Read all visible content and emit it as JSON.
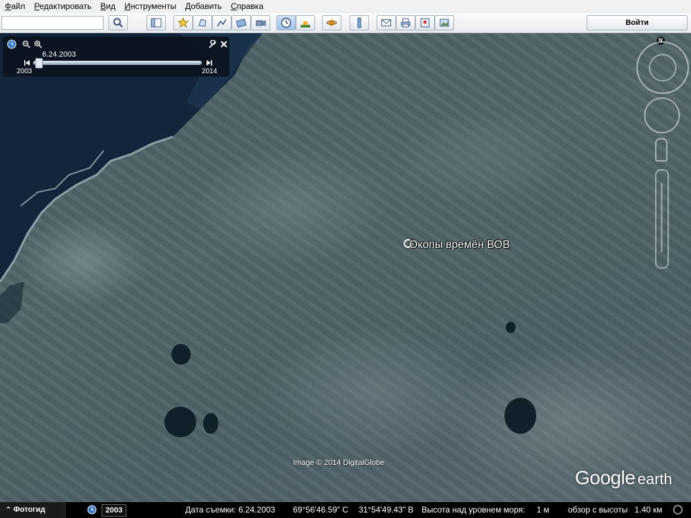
{
  "menu": {
    "items": [
      {
        "label": "Файл",
        "mnemonic": "Ф",
        "rest": "айл"
      },
      {
        "label": "Редактировать",
        "mnemonic": "Р",
        "rest": "едактировать"
      },
      {
        "label": "Вид",
        "mnemonic": "В",
        "rest": "ид"
      },
      {
        "label": "Инструменты",
        "mnemonic": "И",
        "rest": "нструменты"
      },
      {
        "label": "Добавить",
        "mnemonic": "Д",
        "rest": "обавить"
      },
      {
        "label": "Справка",
        "mnemonic": "С",
        "rest": "правка"
      }
    ]
  },
  "toolbar": {
    "search_value": "",
    "signin_label": "Войти",
    "buttons": [
      {
        "name": "search-icon"
      },
      {
        "name": "sidebar-toggle-icon"
      },
      {
        "name": "add-placemark-icon"
      },
      {
        "name": "add-polygon-icon"
      },
      {
        "name": "add-path-icon"
      },
      {
        "name": "image-overlay-icon"
      },
      {
        "name": "record-tour-icon"
      },
      {
        "name": "historical-imagery-icon"
      },
      {
        "name": "sunlight-icon"
      },
      {
        "name": "switch-to-sky-icon"
      },
      {
        "name": "ruler-icon"
      },
      {
        "name": "email-icon"
      },
      {
        "name": "print-icon"
      },
      {
        "name": "view-in-maps-icon"
      },
      {
        "name": "save-image-icon"
      }
    ]
  },
  "time_slider": {
    "current_date": "6.24.2003",
    "start_year": "2003",
    "end_year": "2014",
    "position_fraction": 0.0
  },
  "map": {
    "placemark_label": "Окопы времён ВОВ",
    "copyright": "Image © 2014 DigitalGlobe",
    "logo_google": "Google",
    "logo_earth": "earth",
    "compass_north": "N"
  },
  "status": {
    "photo_tour_label": "Фотогид",
    "year_chip": "2003",
    "capture_date": "Дата съемки: 6.24.2003",
    "latitude": "69°56'46.59\" С",
    "longitude": "31°54'49.43\" В",
    "elevation": "Высота над уровнем моря:     1 м",
    "eye_altitude": "обзор с высоты   1.40 км"
  }
}
